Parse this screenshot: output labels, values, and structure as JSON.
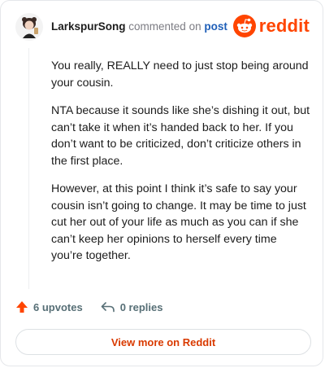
{
  "header": {
    "username": "LarkspurSong",
    "verb": "commented on",
    "post_link": "post",
    "brand": "reddit"
  },
  "comment": {
    "paragraphs": [
      "You really, REALLY need to just stop being around your cousin.",
      "NTA because it sounds like she’s dishing it out, but can’t take it when it’s handed back to her. If you don’t want to be criticized, don’t criticize others in the first place.",
      "However, at this point I think it’s safe to say your cousin isn’t going to change. It may be time to just cut her out of your life as much as you can if she can’t keep her opinions to herself every time you’re together."
    ]
  },
  "actions": {
    "upvotes": "6 upvotes",
    "replies": "0 replies"
  },
  "footer": {
    "view_more": "View more on Reddit"
  },
  "colors": {
    "brand": "#ff4500",
    "link": "#1f5fb8",
    "cta": "#d93a00"
  }
}
